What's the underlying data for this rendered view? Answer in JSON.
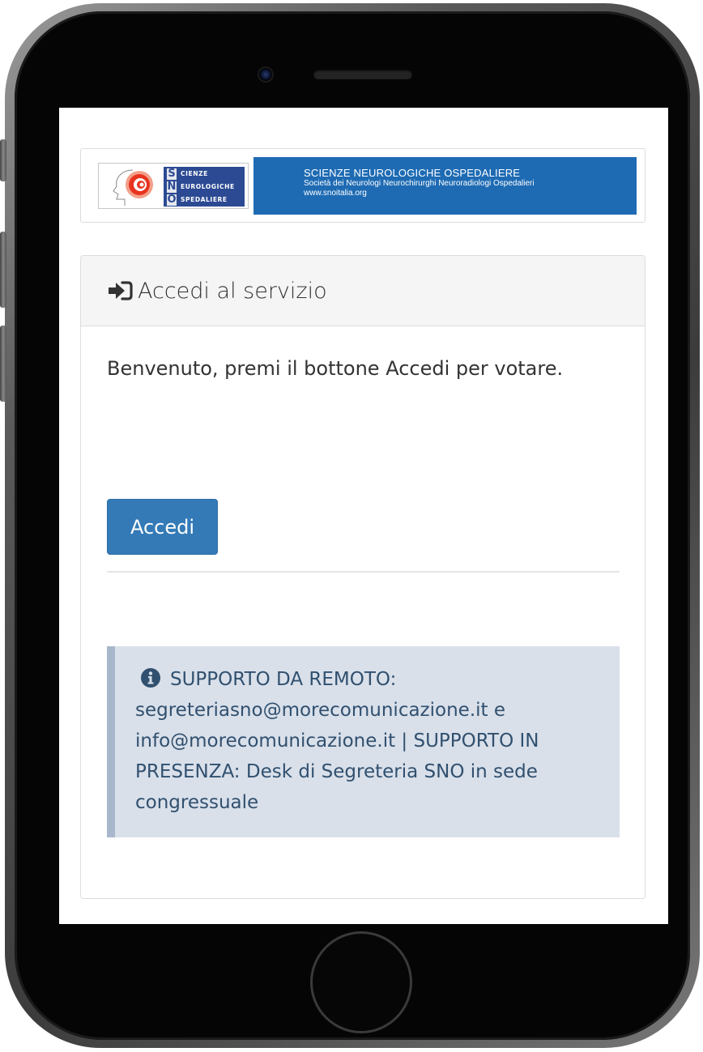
{
  "banner": {
    "logo_letters": [
      "S",
      "N",
      "O"
    ],
    "logo_words": [
      "CIENZE",
      "EUROLOGICHE",
      "SPEDALIERE"
    ],
    "title": "SCIENZE NEUROLOGICHE OSPEDALIERE",
    "subtitle": "Società dei Neurologi Neurochirurghi Neuroradiologi Ospedalieri",
    "url": "www.snoitalia.org"
  },
  "panel": {
    "heading_icon": "sign-in-icon",
    "heading": "Accedi al servizio",
    "welcome": "Benvenuto, premi il bottone Accedi per votare.",
    "button_label": "Accedi"
  },
  "alert": {
    "icon": "info-circle-icon",
    "text": "SUPPORTO DA REMOTO: segreteriasno@morecomunicazione.it e info@morecomunicazione.it | SUPPORTO IN PRESENZA: Desk di Segreteria SNO in sede congressuale"
  },
  "colors": {
    "primary_button": "#337ab7",
    "banner_blue": "#1e6bb3",
    "alert_bg": "#d9e0ea",
    "alert_text": "#31506f"
  }
}
